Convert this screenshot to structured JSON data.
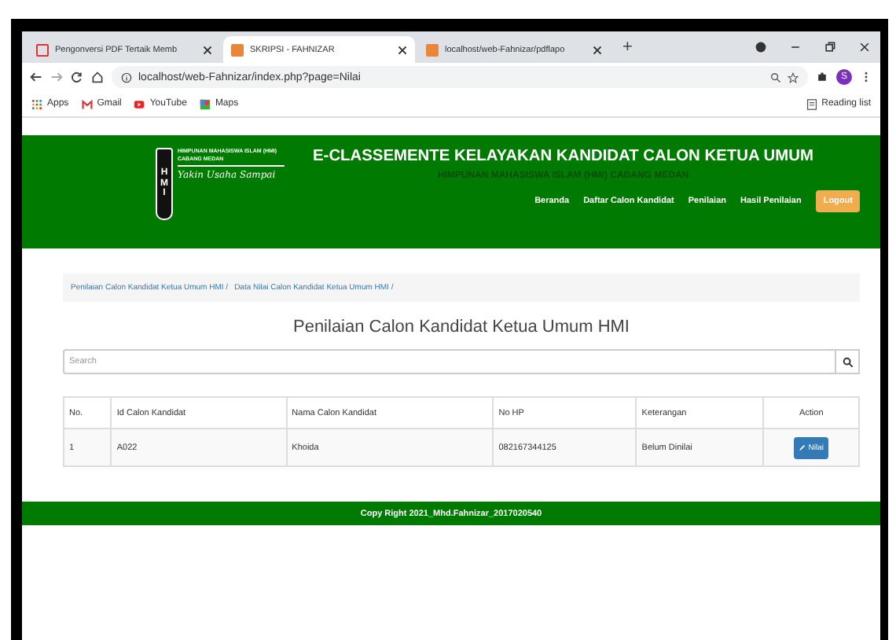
{
  "browser": {
    "tabs": [
      {
        "label": "Pengonversi PDF Tertaik Memb",
        "selected": false,
        "kind": "pdf"
      },
      {
        "label": "SKRIPSI - FAHNIZAR",
        "selected": true,
        "kind": "site"
      },
      {
        "label": "localhost/web-Fahnizar/pdflapo",
        "selected": false,
        "kind": "site"
      }
    ],
    "new_tab": "+",
    "address": "localhost/web-Fahnizar/index.php?page=Nilai",
    "profile": "S",
    "bookmarks": [
      {
        "label": "Apps",
        "kind": "apps"
      },
      {
        "label": "Gmail",
        "kind": "gmail"
      },
      {
        "label": "YouTube",
        "kind": "youtube"
      },
      {
        "label": "Maps",
        "kind": "maps"
      }
    ],
    "reading_list": "Reading list"
  },
  "header": {
    "logo_lines": [
      "HIMPUNAN MAHASISWA ISLAM (HMI)",
      "CABANG MEDAN"
    ],
    "logo_motto": "Yakin Usaha Sampai",
    "logo_letters": "HMI",
    "title": "E-CLASSEMENTE KELAYAKAN KANDIDAT CALON KETUA UMUM",
    "subtitle": "HIMPUNAN MAHASISWA ISLAM (HMI) CABANG MEDAN",
    "nav": [
      {
        "label": "Beranda",
        "kind": "link"
      },
      {
        "label": "Daftar Calon Kandidat",
        "kind": "link"
      },
      {
        "label": "Penilaian",
        "kind": "link"
      },
      {
        "label": "Hasil Penilaian",
        "kind": "link"
      },
      {
        "label": "Logout",
        "kind": "button"
      }
    ]
  },
  "breadcrumb": [
    "Penilaian Calon Kandidat Ketua Umum HMI /",
    "Data Nilai Calon Kandidat Ketua Umum HMI /"
  ],
  "page_title": "Penilaian Calon Kandidat Ketua Umum HMI",
  "search": {
    "placeholder": "Search"
  },
  "table": {
    "columns": [
      "No.",
      "Id Calon Kandidat",
      "Nama Calon Kandidat",
      "No HP",
      "Keterangan",
      "Action"
    ],
    "rows": [
      {
        "cells": [
          "1",
          "A022",
          "Khoida",
          "082167344125",
          "Belum Dinilai"
        ],
        "action": "Nilai"
      }
    ]
  },
  "footer": "Copy Right 2021_Mhd.Fahnizar_2017020540"
}
